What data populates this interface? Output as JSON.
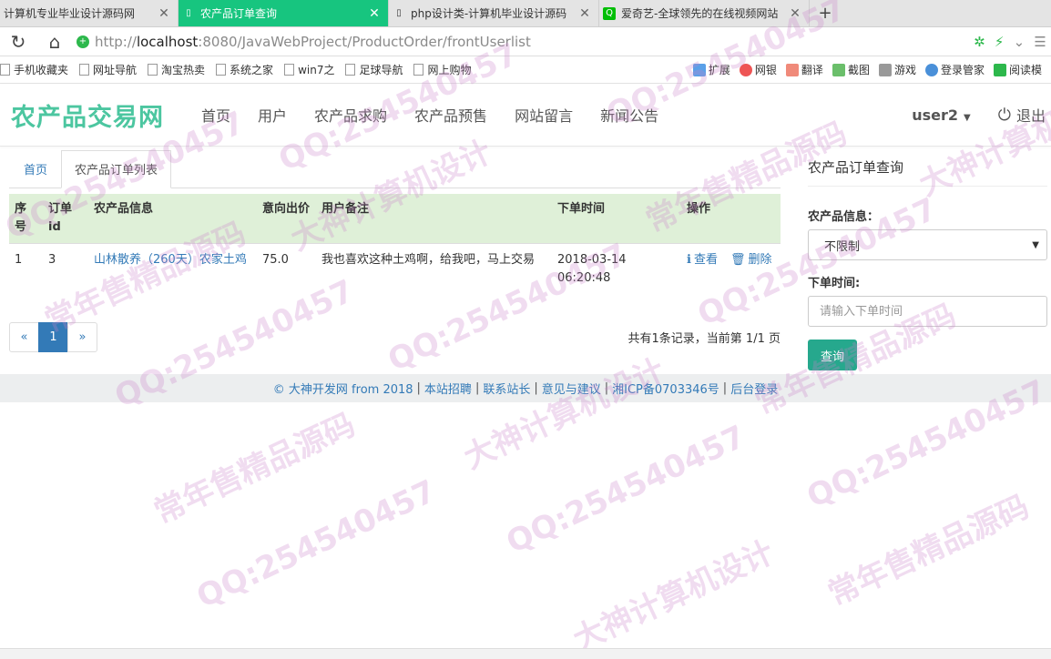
{
  "browser": {
    "tabs": [
      {
        "title": "计算机专业毕业设计源码网",
        "active": false
      },
      {
        "title": "农产品订单查询",
        "active": true
      },
      {
        "title": "php设计类-计算机毕业设计源码",
        "active": false
      },
      {
        "title": "爱奇艺-全球领先的在线视频网站",
        "active": false
      }
    ],
    "url_prefix": "http://",
    "url_host": "localhost",
    "url_path": ":8080/JavaWebProject/ProductOrder/frontUserlist",
    "bookmarks": [
      "手机收藏夹",
      "网址导航",
      "淘宝热卖",
      "系统之家",
      "win7之",
      "足球导航",
      "网上购物"
    ],
    "tools": [
      "扩展",
      "网银",
      "翻译",
      "截图",
      "游戏",
      "登录管家",
      "阅读模"
    ]
  },
  "site": {
    "brand": "农产品交易网",
    "nav": [
      "首页",
      "用户",
      "农产品求购",
      "农产品预售",
      "网站留言",
      "新闻公告"
    ],
    "user": "user2",
    "logout": "退出"
  },
  "breadcrumb": {
    "home": "首页",
    "current": "农产品订单列表"
  },
  "table": {
    "headers": [
      "序号",
      "订单id",
      "农产品信息",
      "意向出价",
      "用户备注",
      "下单时间",
      "操作"
    ],
    "rows": [
      {
        "index": "1",
        "order_id": "3",
        "product": "山林散养（260天）农家土鸡",
        "price": "75.0",
        "remark": "我也喜欢这种土鸡啊，给我吧，马上交易",
        "time": "2018-03-14 06:20:48",
        "view": "查看",
        "delete": "删除"
      }
    ]
  },
  "pagination": {
    "prev": "«",
    "current": "1",
    "next": "»",
    "info": "共有1条记录，当前第 1/1 页"
  },
  "sidebar": {
    "title": "农产品订单查询",
    "product_label": "农产品信息：",
    "product_value": "不限制",
    "time_label": "下单时间:",
    "time_placeholder": "请输入下单时间",
    "submit": "查询"
  },
  "footer": {
    "links": [
      "© 大神开发网 from 2018",
      "本站招聘",
      "联系站长",
      "意见与建议",
      "湘ICP备0703346号",
      "后台登录"
    ]
  },
  "watermark": {
    "texts": [
      "QQ:254540457",
      "常年售精品源码",
      "大神计算机设计"
    ]
  }
}
